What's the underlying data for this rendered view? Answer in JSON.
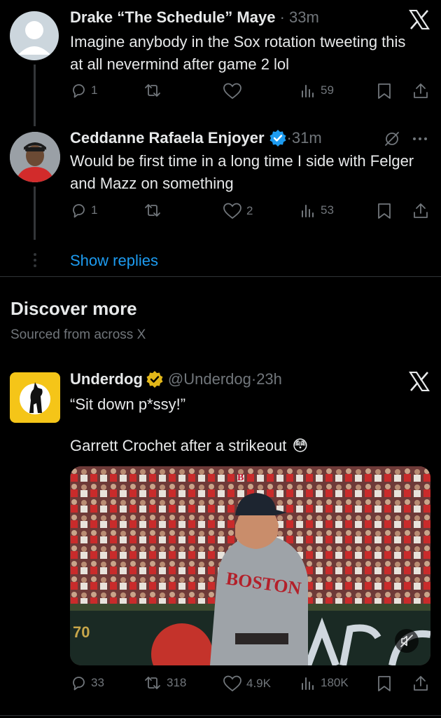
{
  "tweet1": {
    "author": "Drake “The Schedule” Maye",
    "time": "33m",
    "text": "Imagine anybody in the Sox rotation tweeting this at all nevermind after game 2 lol",
    "replies": "1",
    "retweets": "",
    "likes": "",
    "views": "59"
  },
  "tweet2": {
    "author": "Ceddanne Rafaela Enjoyer",
    "time": "31m",
    "text": "Would be first time in a long time I side with Felger and Mazz on something",
    "replies": "1",
    "retweets": "",
    "likes": "2",
    "views": "53"
  },
  "show_replies": "Show replies",
  "discover": {
    "title": "Discover more",
    "subtitle": "Sourced from across X"
  },
  "tweet3": {
    "author": "Underdog",
    "handle": "@Underdog",
    "time": "23h",
    "line1": "“Sit down p*ssy!”",
    "line2": "Garrett Crochet after a strikeout",
    "emoji": "😳",
    "scoreboard_number": "70",
    "jersey_text": "BOSTON",
    "replies": "33",
    "retweets": "318",
    "likes": "4.9K",
    "views": "180K"
  },
  "colors": {
    "background": "#000000",
    "text": "#e7e9ea",
    "muted": "#71767b",
    "link": "#1d9bf0",
    "verified_blue": "#1d9bf0",
    "verified_gold": "#e2b719",
    "underdog_yellow": "#f5c518"
  }
}
